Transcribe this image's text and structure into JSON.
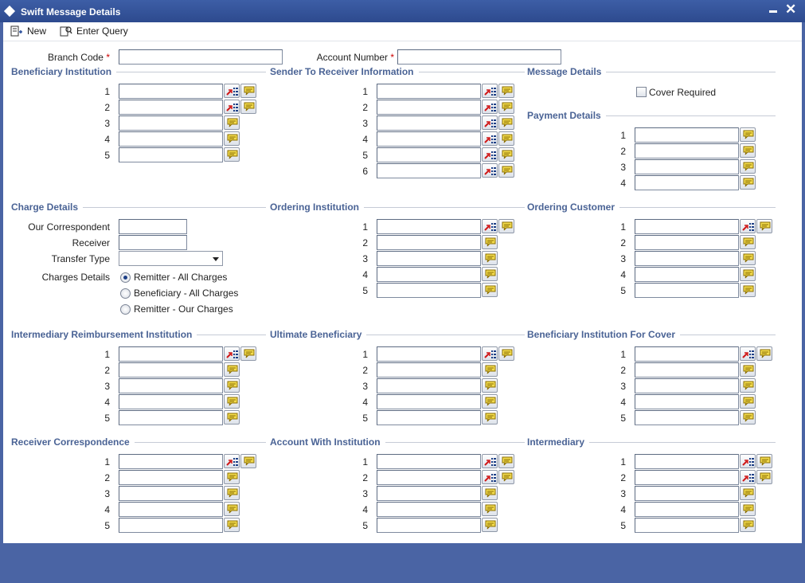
{
  "window": {
    "title": "Swift Message Details"
  },
  "toolbar": {
    "new_label": "New",
    "enter_query_label": "Enter Query"
  },
  "header": {
    "branch_code_label": "Branch Code",
    "account_number_label": "Account Number",
    "required_mark": "*"
  },
  "sections": {
    "beneficiary_institution": "Beneficiary Institution",
    "sender_to_receiver": "Sender To Receiver Information",
    "message_details": "Message Details",
    "payment_details": "Payment Details",
    "charge_details": "Charge Details",
    "ordering_institution": "Ordering Institution",
    "ordering_customer": "Ordering Customer",
    "intermediary_reimbursement": "Intermediary Reimbursement Institution",
    "ultimate_beneficiary": "Ultimate Beneficiary",
    "beneficiary_institution_cover": "Beneficiary Institution For Cover",
    "receiver_correspondence": "Receiver Correspondence",
    "account_with_institution": "Account With Institution",
    "intermediary": "Intermediary"
  },
  "message_details": {
    "cover_required_label": "Cover Required",
    "cover_required_checked": false
  },
  "charge_details": {
    "our_correspondent_label": "Our Correspondent",
    "receiver_label": "Receiver",
    "transfer_type_label": "Transfer Type",
    "transfer_type_value": "",
    "charges_details_label": "Charges Details",
    "options": [
      "Remitter - All Charges",
      "Beneficiary - All Charges",
      "Remitter - Our Charges"
    ],
    "selected_option": "Remitter - All Charges"
  },
  "row_numbers": [
    "1",
    "2",
    "3",
    "4",
    "5",
    "6"
  ],
  "icons": {
    "list": "list-lookup-icon",
    "note": "speech-bubble-icon"
  },
  "colors": {
    "titlebar": "#2d4a8e",
    "section_title": "#4a6395",
    "required": "#cc0000",
    "background": "#4a64a4"
  }
}
